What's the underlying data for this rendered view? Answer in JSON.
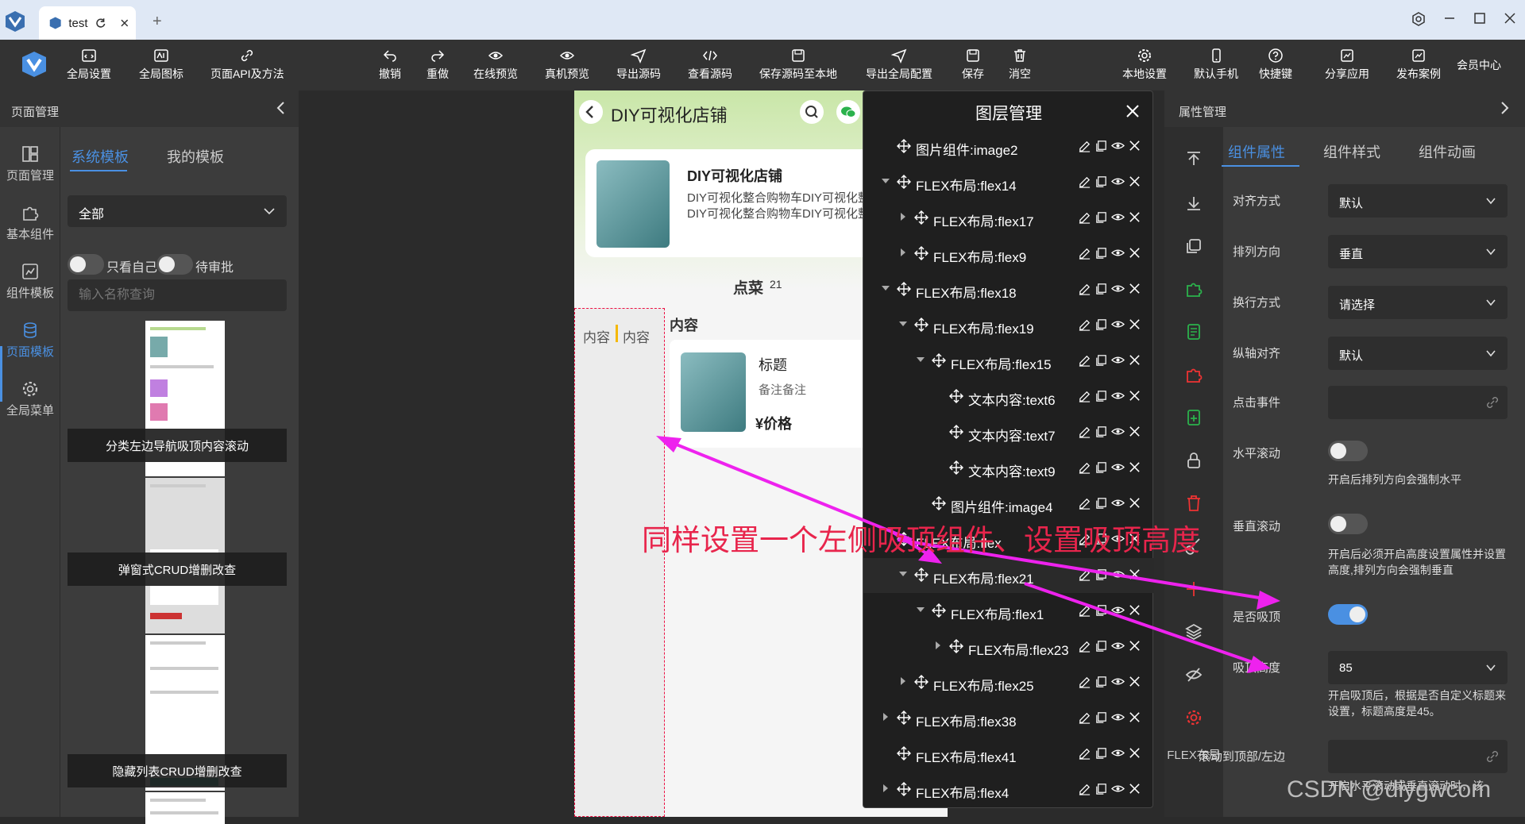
{
  "tabbar": {
    "tab_title": "test",
    "new_tab": "+"
  },
  "toolbar": {
    "items": [
      "全局设置",
      "全局图标",
      "页面API及方法",
      "撤销",
      "重做",
      "在线预览",
      "真机预览",
      "导出源码",
      "查看源码",
      "保存源码至本地",
      "导出全局配置",
      "保存",
      "消空",
      "本地设置",
      "默认手机",
      "快捷键",
      "分享应用",
      "发布案例",
      "会员中心"
    ]
  },
  "left_panel": {
    "title": "页面管理",
    "nav": [
      "页面管理",
      "基本组件",
      "组件模板",
      "页面模板",
      "全局菜单"
    ],
    "tabs": [
      "系统模板",
      "我的模板"
    ],
    "filter": "全部",
    "toggle_mine": "只看自己",
    "toggle_pending": "待审批",
    "search_placeholder": "输入名称查询",
    "templates": [
      "分类左边导航吸顶内容滚动",
      "弹窗式CRUD增删改查",
      "隐藏列表CRUD增删改查"
    ]
  },
  "phone": {
    "title": "DIY可视化店铺",
    "shop_name": "DIY可视化店铺",
    "shop_desc_1": "DIY可视化整合购物车DIY可视化整",
    "shop_desc_2": "DIY可视化整合购物车DIY可视化整",
    "order_label": "点菜",
    "order_count": "21",
    "side_item_1": "内容",
    "side_item_2": "内容",
    "content_label": "内容",
    "product_title": "标题",
    "product_note": "备注备注",
    "product_price": "¥价格"
  },
  "layers": {
    "title": "图层管理",
    "rows": [
      {
        "label": "图片组件:image2",
        "exp": ""
      },
      {
        "label": "FLEX布局:flex14",
        "exp": "down"
      },
      {
        "label": "FLEX布局:flex17",
        "exp": "right"
      },
      {
        "label": "FLEX布局:flex9",
        "exp": "right"
      },
      {
        "label": "FLEX布局:flex18",
        "exp": "down"
      },
      {
        "label": "FLEX布局:flex19",
        "exp": "down"
      },
      {
        "label": "FLEX布局:flex15",
        "exp": "down"
      },
      {
        "label": "文本内容:text6",
        "exp": ""
      },
      {
        "label": "文本内容:text7",
        "exp": ""
      },
      {
        "label": "文本内容:text9",
        "exp": ""
      },
      {
        "label": "图片组件:image4",
        "exp": ""
      },
      {
        "label": "FLEX布局:flex",
        "exp": ""
      },
      {
        "label": "FLEX布局:flex21",
        "exp": "down"
      },
      {
        "label": "FLEX布局:flex1",
        "exp": "down"
      },
      {
        "label": "FLEX布局:flex23",
        "exp": "right"
      },
      {
        "label": "FLEX布局:flex25",
        "exp": "right"
      },
      {
        "label": "FLEX布局:flex38",
        "exp": "right"
      },
      {
        "label": "FLEX布局:flex41",
        "exp": ""
      },
      {
        "label": "FLEX布局:flex4",
        "exp": "right"
      }
    ]
  },
  "right_panel": {
    "title": "属性管理",
    "tabs": [
      "组件属性",
      "组件样式",
      "组件动画"
    ],
    "flex_label": "FLEX布局",
    "fields": {
      "align_label": "对齐方式",
      "align_value": "默认",
      "direction_label": "排列方向",
      "direction_value": "垂直",
      "wrap_label": "换行方式",
      "wrap_value": "请选择",
      "cross_label": "纵轴对齐",
      "cross_value": "默认",
      "click_label": "点击事件",
      "hscroll_label": "水平滚动",
      "hscroll_hint": "开启后排列方向会强制水平",
      "vscroll_label": "垂直滚动",
      "vscroll_hint": "开启后必须开启高度设置属性并设置高度,排列方向会强制垂直",
      "sticky_label": "是否吸顶",
      "sticky_height_label": "吸顶高度",
      "sticky_height_value": "85",
      "sticky_hint": "开启吸顶后，根据是否自定义标题来设置，标题高度是45。",
      "scroll_to_label": "滚动到顶部/左边",
      "scroll_to_hint": "开启水平滚动或垂直滚动时，该"
    }
  },
  "annotation": {
    "text": "同样设置一个左侧吸顶组件、设置吸顶高度",
    "color": "#e8254c"
  },
  "watermark": "CSDN @diygwcom",
  "colors": {
    "accent": "#4a90e2",
    "annotation_arrow": "#ee22ee"
  }
}
